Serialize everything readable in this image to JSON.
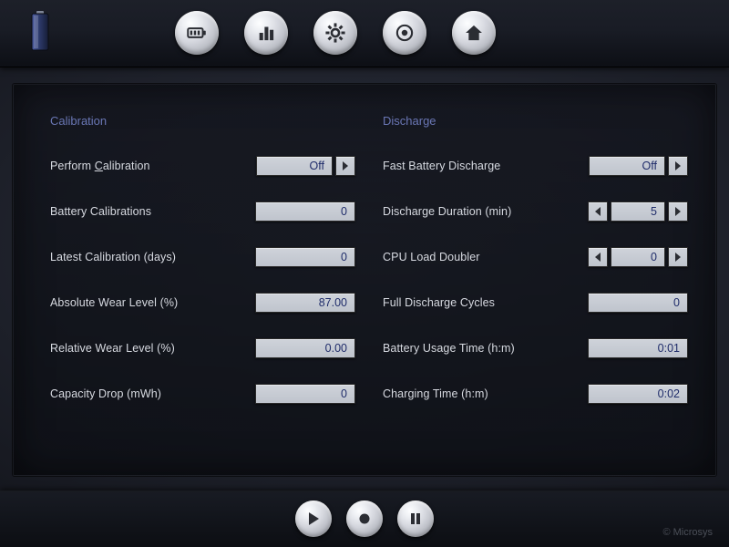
{
  "sections": {
    "calibration": {
      "title": "Calibration",
      "rows": {
        "perform": {
          "label_pre": "Perform ",
          "label_ul": "C",
          "label_post": "alibration",
          "value": "Off"
        },
        "count": {
          "label": "Battery Calibrations",
          "value": "0"
        },
        "latest": {
          "label": "Latest Calibration (days)",
          "value": "0"
        },
        "abswear": {
          "label": "Absolute Wear Level (%)",
          "value": "87.00"
        },
        "relwear": {
          "label": "Relative Wear Level (%)",
          "value": "0.00"
        },
        "capdrop": {
          "label": "Capacity Drop (mWh)",
          "value": "0"
        }
      }
    },
    "discharge": {
      "title": "Discharge",
      "rows": {
        "fast": {
          "label": "Fast Battery Discharge",
          "value": "Off"
        },
        "duration": {
          "label": "Discharge Duration (min)",
          "value": "5"
        },
        "doubler": {
          "label": "CPU Load Doubler",
          "value": "0"
        },
        "cycles": {
          "label": "Full Discharge Cycles",
          "value": "0"
        },
        "usage": {
          "label": "Battery Usage Time (h:m)",
          "value": "0:01"
        },
        "charge": {
          "label": "Charging Time (h:m)",
          "value": "0:02"
        }
      }
    }
  },
  "footer": {
    "copyright": "© Microsys"
  }
}
